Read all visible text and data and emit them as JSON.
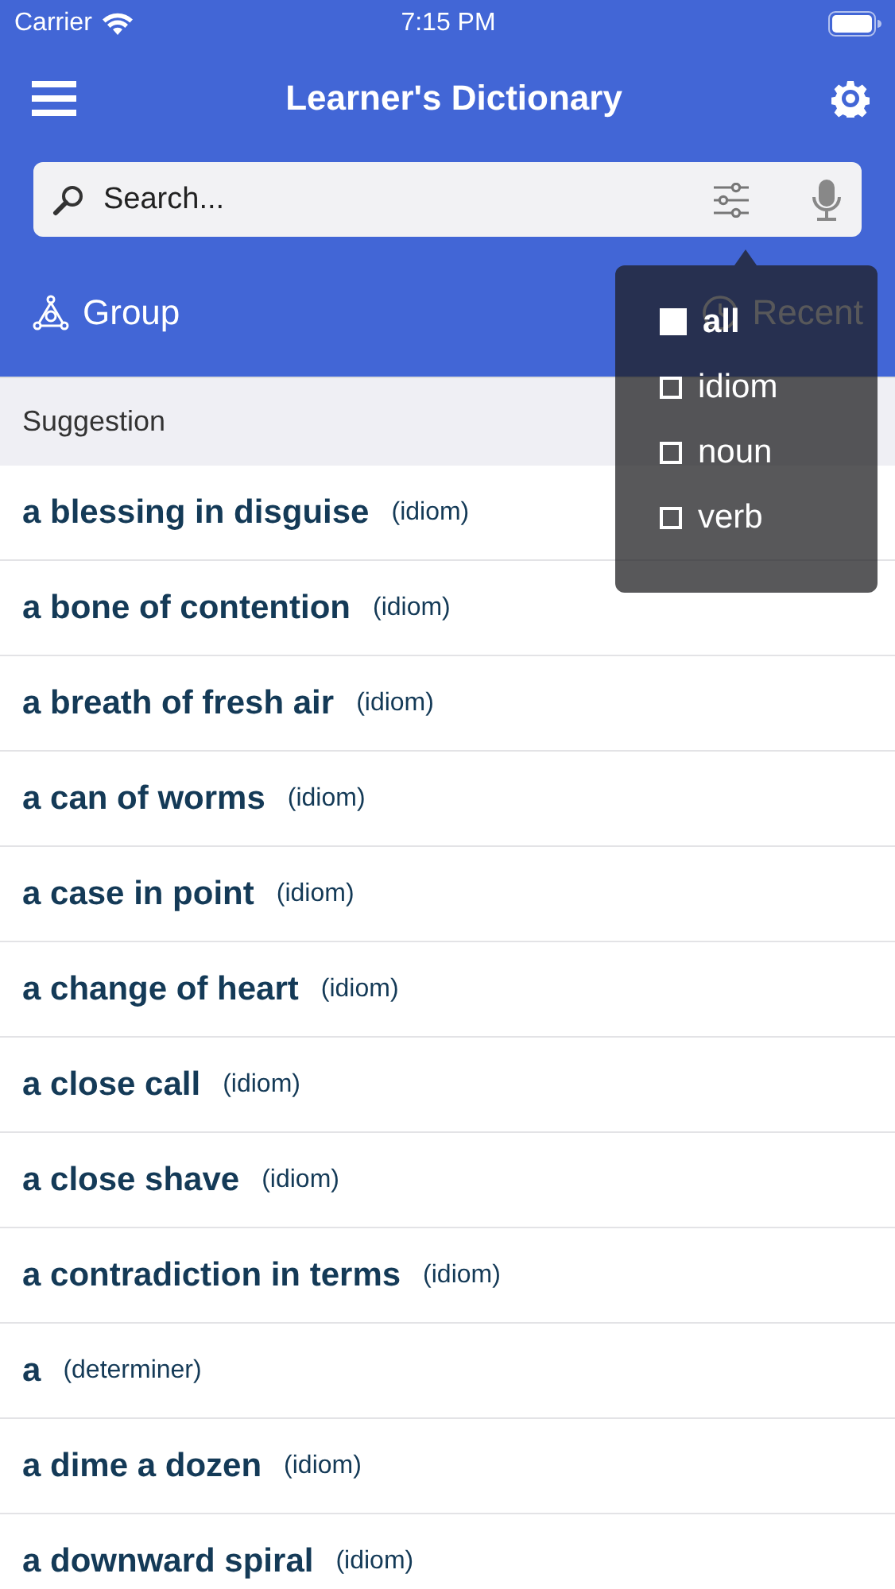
{
  "status_bar": {
    "carrier": "Carrier",
    "time": "7:15 PM"
  },
  "nav_bar": {
    "title": "Learner's Dictionary"
  },
  "search": {
    "placeholder": "Search..."
  },
  "tabs": [
    {
      "label": "Group",
      "kind": "group"
    },
    {
      "label": "Recent",
      "kind": "recent"
    }
  ],
  "section_header": "Suggestion",
  "entries": [
    {
      "term": "a blessing in disguise",
      "part_of_speech": "(idiom)"
    },
    {
      "term": "a bone of contention",
      "part_of_speech": "(idiom)"
    },
    {
      "term": "a breath of fresh air",
      "part_of_speech": "(idiom)"
    },
    {
      "term": "a can of worms",
      "part_of_speech": "(idiom)"
    },
    {
      "term": "a case in point",
      "part_of_speech": "(idiom)"
    },
    {
      "term": "a change of heart",
      "part_of_speech": "(idiom)"
    },
    {
      "term": "a close call",
      "part_of_speech": "(idiom)"
    },
    {
      "term": "a close shave",
      "part_of_speech": "(idiom)"
    },
    {
      "term": "a contradiction in terms",
      "part_of_speech": "(idiom)"
    },
    {
      "term": "a",
      "part_of_speech": "(determiner)"
    },
    {
      "term": "a dime a dozen",
      "part_of_speech": "(idiom)"
    },
    {
      "term": "a downward spiral",
      "part_of_speech": "(idiom)"
    }
  ],
  "filter_menu": {
    "options": [
      {
        "label": "all",
        "checked": true
      },
      {
        "label": "idiom",
        "checked": false
      },
      {
        "label": "noun",
        "checked": false
      },
      {
        "label": "verb",
        "checked": false
      }
    ]
  }
}
